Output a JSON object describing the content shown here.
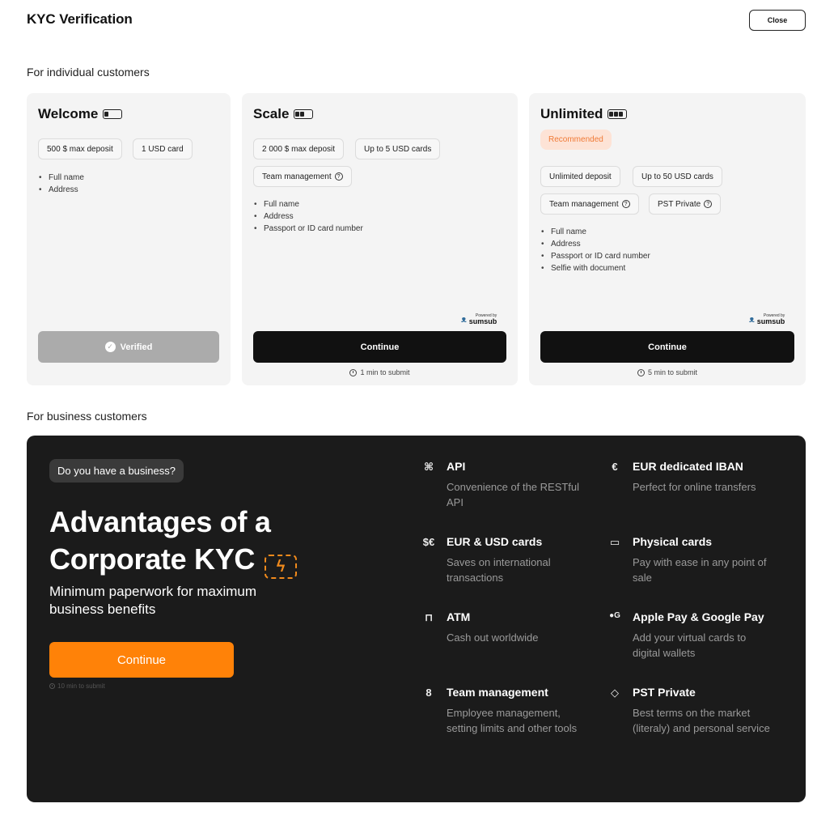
{
  "header": {
    "title": "KYC Verification",
    "close_label": "Close"
  },
  "sections": {
    "individual": "For individual customers",
    "business": "For business customers"
  },
  "tiers": [
    {
      "name": "Welcome",
      "battery_level": 1,
      "chips": [
        "500 $ max deposit",
        "1 USD card"
      ],
      "requirements": [
        "Full name",
        "Address"
      ],
      "button": "Verified",
      "state": "verified"
    },
    {
      "name": "Scale",
      "battery_level": 2,
      "chips": [
        "2 000 $ max deposit",
        "Up to 5 USD cards",
        "Team management"
      ],
      "requirements": [
        "Full name",
        "Address",
        "Passport or ID card number"
      ],
      "powered_small": "Powered by",
      "powered_brand": "sumsub",
      "button": "Continue",
      "submit_note": "1 min to submit"
    },
    {
      "name": "Unlimited",
      "battery_level": 3,
      "badge": "Recommended",
      "chips": [
        "Unlimited deposit",
        "Up to 50 USD cards",
        "Team management",
        "PST Private"
      ],
      "requirements": [
        "Full name",
        "Address",
        "Passport or ID card number",
        "Selfie with document"
      ],
      "powered_small": "Powered by",
      "powered_brand": "sumsub",
      "button": "Continue",
      "submit_note": "5 min to submit"
    }
  ],
  "business": {
    "pill": "Do you have a business?",
    "headline": "Advantages of a Corporate KYC",
    "subheadline": "Minimum paperwork for maximum business benefits",
    "button": "Continue",
    "submit_note": "10 min to submit",
    "features": [
      {
        "icon": "api-icon",
        "title": "API",
        "desc": "Convenience of the RESTful API"
      },
      {
        "icon": "iban-icon",
        "title": "EUR dedicated IBAN",
        "desc": "Perfect for online transfers"
      },
      {
        "icon": "currency-icon",
        "title": "EUR & USD cards",
        "desc": "Saves on international transactions"
      },
      {
        "icon": "physical-card-icon",
        "title": "Physical cards",
        "desc": "Pay with ease in any point of sale"
      },
      {
        "icon": "atm-icon",
        "title": "ATM",
        "desc": "Cash out worldwide"
      },
      {
        "icon": "wallet-pay-icon",
        "title": "Apple Pay & Google Pay",
        "desc": "Add your virtual cards to digital wallets"
      },
      {
        "icon": "team-icon",
        "title": "Team management",
        "desc": "Employee management, setting limits and other tools"
      },
      {
        "icon": "diamond-icon",
        "title": "PST Private",
        "desc": "Best terms on the market (literaly) and personal service"
      }
    ]
  },
  "colors": {
    "accent": "#ff8208",
    "dark_panel": "#1b1b1b",
    "badge_bg": "#fde3d6",
    "badge_text": "#f07a36",
    "verified_btn": "#ababab"
  }
}
